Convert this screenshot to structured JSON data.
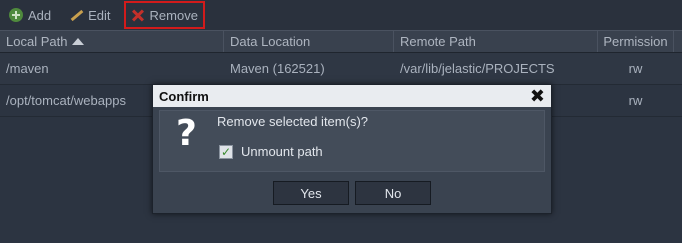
{
  "toolbar": {
    "add_label": "Add",
    "edit_label": "Edit",
    "remove_label": "Remove"
  },
  "grid": {
    "columns": [
      "Local Path",
      "Data Location",
      "Remote Path",
      "Permission"
    ],
    "sort_column": "Local Path",
    "sort_direction": "ascending",
    "rows": [
      {
        "local_path": "/maven",
        "data_location": "Maven (162521)",
        "remote_path": "/var/lib/jelastic/PROJECTS",
        "permission": "rw"
      },
      {
        "local_path": "/opt/tomcat/webapps",
        "data_location": "",
        "remote_path": "",
        "permission": "rw"
      }
    ]
  },
  "dialog": {
    "title": "Confirm",
    "icon": "question-icon",
    "icon_glyph": "?",
    "message": "Remove selected item(s)?",
    "checkbox_label": "Unmount path",
    "checkbox_checked": true,
    "checkbox_glyph": "✓",
    "close_glyph": "✖",
    "yes_label": "Yes",
    "no_label": "No"
  },
  "colors": {
    "highlight_border": "#d21b1b",
    "background": "#2c3441"
  }
}
